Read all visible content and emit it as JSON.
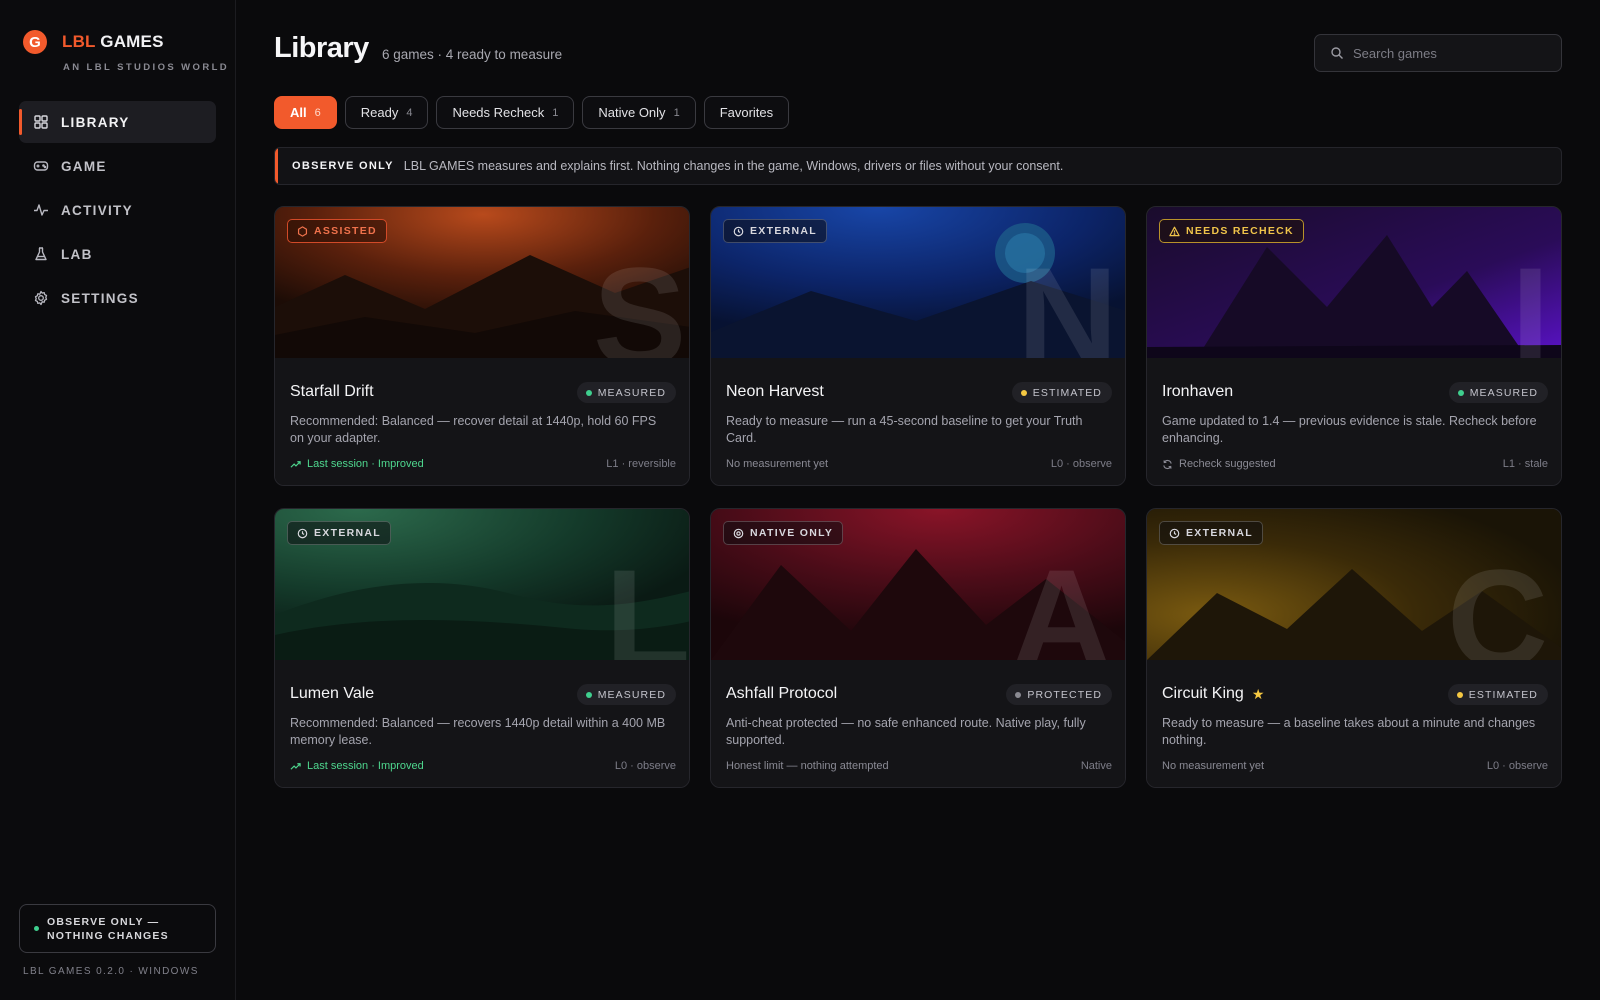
{
  "brand": {
    "logo_letter": "G",
    "name_accent": "LBL",
    "name_rest": "GAMES",
    "subtitle": "AN LBL STUDIOS WORLD"
  },
  "nav": {
    "items": [
      {
        "label": "LIBRARY",
        "icon": "grid-icon",
        "active": true
      },
      {
        "label": "GAME",
        "icon": "gamepad-icon",
        "active": false
      },
      {
        "label": "ACTIVITY",
        "icon": "pulse-icon",
        "active": false
      },
      {
        "label": "LAB",
        "icon": "flask-icon",
        "active": false
      },
      {
        "label": "SETTINGS",
        "icon": "gear-icon",
        "active": false
      }
    ]
  },
  "sidebar_footer": {
    "observe_label": "OBSERVE ONLY — NOTHING CHANGES",
    "version": "LBL GAMES 0.2.0 · WINDOWS"
  },
  "header": {
    "title": "Library",
    "subtitle": "6 games · 4 ready to measure",
    "search_placeholder": "Search games"
  },
  "filters": [
    {
      "label": "All",
      "count": "6",
      "active": true
    },
    {
      "label": "Ready",
      "count": "4",
      "active": false
    },
    {
      "label": "Needs Recheck",
      "count": "1",
      "active": false
    },
    {
      "label": "Native Only",
      "count": "1",
      "active": false
    },
    {
      "label": "Favorites",
      "count": "",
      "active": false
    }
  ],
  "banner": {
    "label": "OBSERVE ONLY",
    "text": "LBL GAMES measures and explains first. Nothing changes in the game, Windows, drivers or files without your consent."
  },
  "colors": {
    "accent": "#f25a2c",
    "measured": "#3fcf8e",
    "estimated": "#f5c842",
    "protected": "#8a8a92",
    "improved": "#4ed68e"
  },
  "games": [
    {
      "title": "Starfall Drift",
      "letter": "S",
      "badge": "ASSISTED",
      "badge_type": "assisted",
      "status": "MEASURED",
      "status_type": "measured",
      "desc": "Recommended: Balanced — recover detail at 1440p, hold 60 FPS on your adapter.",
      "foot_left": "Last session · Improved",
      "foot_left_type": "improved",
      "foot_right": "L1 · reversible",
      "theme": "orange",
      "favorite": false
    },
    {
      "title": "Neon Harvest",
      "letter": "N",
      "badge": "EXTERNAL",
      "badge_type": "external",
      "status": "ESTIMATED",
      "status_type": "estimated",
      "desc": "Ready to measure — run a 45-second baseline to get your Truth Card.",
      "foot_left": "No measurement yet",
      "foot_left_type": "plain",
      "foot_right": "L0 · observe",
      "theme": "blue",
      "favorite": false
    },
    {
      "title": "Ironhaven",
      "letter": "I",
      "badge": "NEEDS RECHECK",
      "badge_type": "recheck",
      "status": "MEASURED",
      "status_type": "measured",
      "desc": "Game updated to 1.4 — previous evidence is stale. Recheck before enhancing.",
      "foot_left": "Recheck suggested",
      "foot_left_type": "recheck",
      "foot_right": "L1 · stale",
      "theme": "purple",
      "favorite": false
    },
    {
      "title": "Lumen Vale",
      "letter": "L",
      "badge": "EXTERNAL",
      "badge_type": "external",
      "status": "MEASURED",
      "status_type": "measured",
      "desc": "Recommended: Balanced — recovers 1440p detail within a 400 MB memory lease.",
      "foot_left": "Last session · Improved",
      "foot_left_type": "improved",
      "foot_right": "L0 · observe",
      "theme": "green",
      "favorite": false
    },
    {
      "title": "Ashfall Protocol",
      "letter": "A",
      "badge": "NATIVE ONLY",
      "badge_type": "native",
      "status": "PROTECTED",
      "status_type": "protected",
      "desc": "Anti-cheat protected — no safe enhanced route. Native play, fully supported.",
      "foot_left": "Honest limit — nothing attempted",
      "foot_left_type": "plain",
      "foot_right": "Native",
      "theme": "red",
      "favorite": false
    },
    {
      "title": "Circuit King",
      "letter": "C",
      "badge": "EXTERNAL",
      "badge_type": "external",
      "status": "ESTIMATED",
      "status_type": "estimated",
      "desc": "Ready to measure — a baseline takes about a minute and changes nothing.",
      "foot_left": "No measurement yet",
      "foot_left_type": "plain",
      "foot_right": "L0 · observe",
      "theme": "gold",
      "favorite": true
    }
  ]
}
